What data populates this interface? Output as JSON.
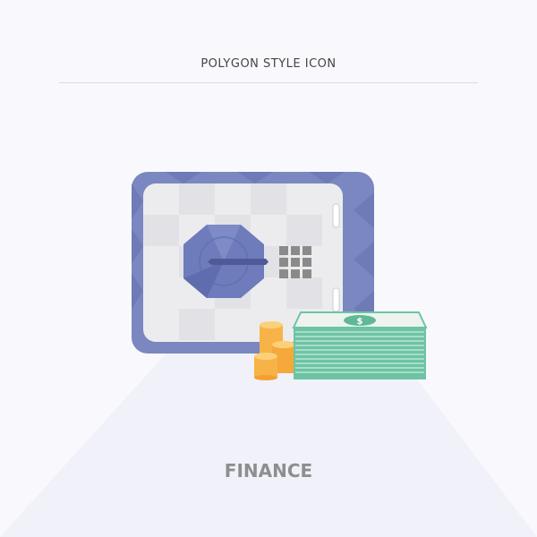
{
  "header": {
    "title": "POLYGON STYLE ICON"
  },
  "footer": {
    "label": "FINANCE"
  },
  "illustration": {
    "money_symbol": "$",
    "colors": {
      "background": "#f9f9fd",
      "pedestal": "#f0f1f9",
      "safe_frame": "#7a87c0",
      "safe_door": "#ececee",
      "dial": "#6f7cbb",
      "handle": "#4f5a99",
      "keypad": "#8a8a8a",
      "money": "#6cc4a4",
      "coins": "#f7b347"
    }
  }
}
